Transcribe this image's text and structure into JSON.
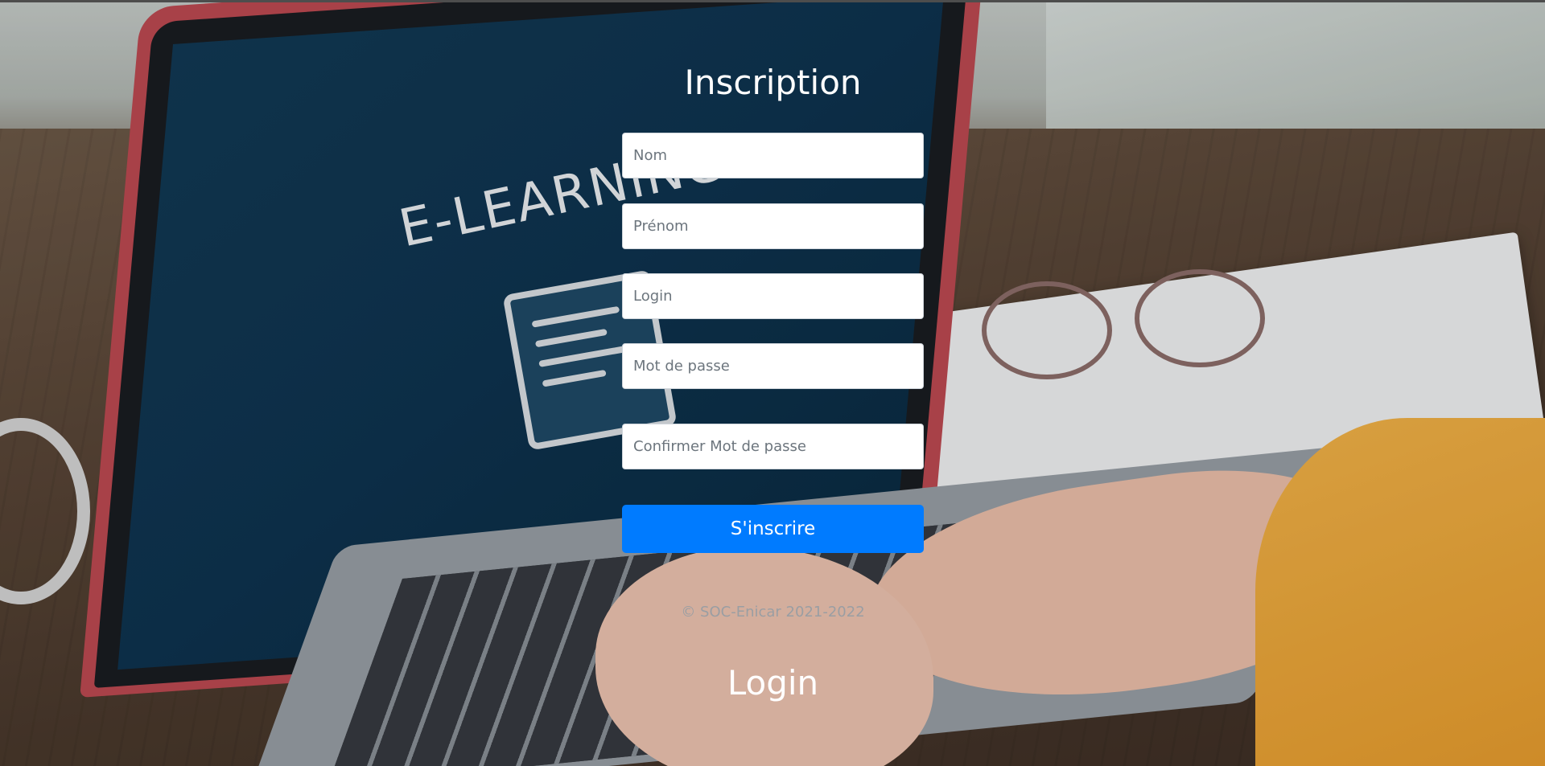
{
  "form": {
    "title": "Inscription",
    "fields": {
      "nom_placeholder": "Nom",
      "prenom_placeholder": "Prénom",
      "login_placeholder": "Login",
      "password_placeholder": "Mot de passe",
      "confirm_password_placeholder": "Confirmer Mot de passe"
    },
    "submit_label": "S'inscrire",
    "copyright": "© SOC-Enicar 2021-2022",
    "login_link": "Login"
  },
  "background": {
    "screen_text": "E-LEARNING"
  },
  "colors": {
    "primary_button": "#007bff",
    "title_text": "#ffffff"
  }
}
